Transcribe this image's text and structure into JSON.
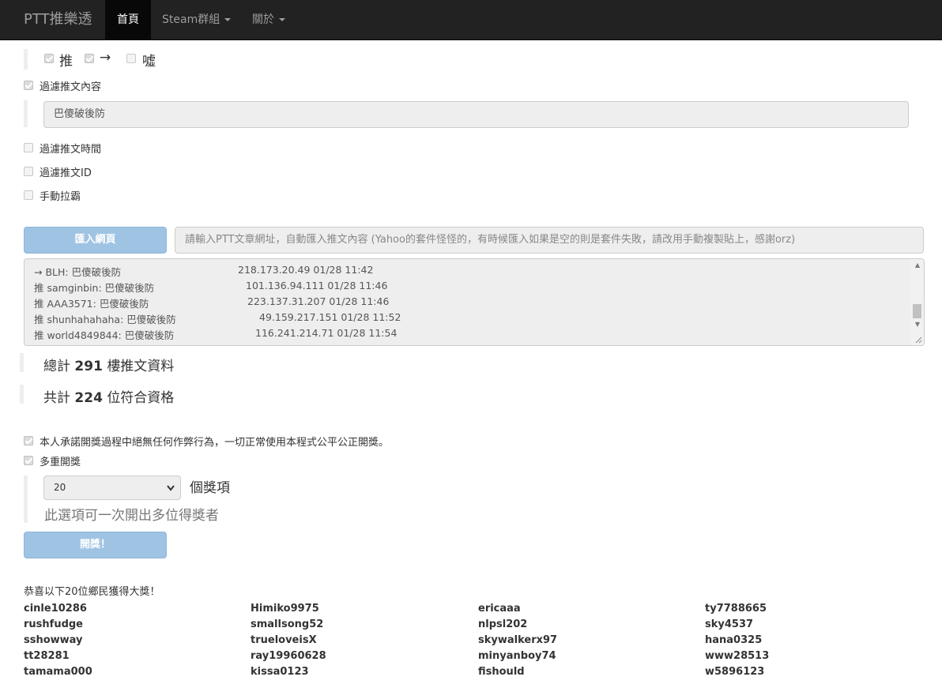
{
  "nav": {
    "brand": "PTT推樂透",
    "items": [
      {
        "label": "首頁",
        "active": true
      },
      {
        "label": "Steam群組",
        "dropdown": true
      },
      {
        "label": "關於",
        "dropdown": true
      }
    ]
  },
  "push_types": {
    "push": {
      "label": "推",
      "checked": true
    },
    "arrow": {
      "label": "→",
      "checked": true
    },
    "boo": {
      "label": "噓",
      "checked": false
    }
  },
  "filters": {
    "content": {
      "label": "過濾推文內容",
      "checked": true,
      "value": "巴傻破後防"
    },
    "time": {
      "label": "過濾推文時間",
      "checked": false
    },
    "id": {
      "label": "過濾推文ID",
      "checked": false
    },
    "manual": {
      "label": "手動拉霸",
      "checked": false
    }
  },
  "import": {
    "button_label": "匯入網頁",
    "placeholder": "請輸入PTT文章網址，自動匯入推文內容 (Yahoo的套件怪怪的，有時候匯入如果是空的則是套件失敗，請改用手動複製貼上，感謝orz)"
  },
  "comments": [
    {
      "text": "→ BLH: 巴傻破後防",
      "ip_time": "218.173.20.49 01/28 11:42"
    },
    {
      "text": "推 samginbin: 巴傻破後防",
      "ip_time": "101.136.94.111 01/28 11:46"
    },
    {
      "text": "推 AAA3571: 巴傻破後防",
      "ip_time": "223.137.31.207 01/28 11:46"
    },
    {
      "text": "推 shunhahahaha: 巴傻破後防",
      "ip_time": "49.159.217.151 01/28 11:52"
    },
    {
      "text": "推 world4849844: 巴傻破後防",
      "ip_time": "116.241.214.71 01/28 11:54"
    }
  ],
  "stats": {
    "total_prefix": "總計",
    "total_count": "291",
    "total_suffix": "樓推文資料",
    "qualified_prefix": "共計",
    "qualified_count": "224",
    "qualified_suffix": "位符合資格"
  },
  "draw": {
    "pledge": {
      "label": "本人承諾開獎過程中絕無任何作弊行為，一切正常使用本程式公平公正開獎。",
      "checked": true
    },
    "multi": {
      "label": "多重開獎",
      "checked": true
    },
    "prize_count": "20",
    "prize_unit": "個獎項",
    "hint": "此選項可一次開出多位得獎者",
    "button_label": "開獎！"
  },
  "results": {
    "heading": "恭喜以下20位鄉民獲得大獎！",
    "winners": [
      "cinle10286",
      "Himiko9975",
      "ericaaa",
      "ty7788665",
      "rushfudge",
      "smallsong52",
      "nlpsl202",
      "sky4537",
      "sshowway",
      "trueloveisX",
      "skywalkerx97",
      "hana0325",
      "tt28281",
      "ray19960628",
      "minyanboy74",
      "www28513",
      "tamama000",
      "kissa0123",
      "fishould",
      "w5896123"
    ]
  }
}
